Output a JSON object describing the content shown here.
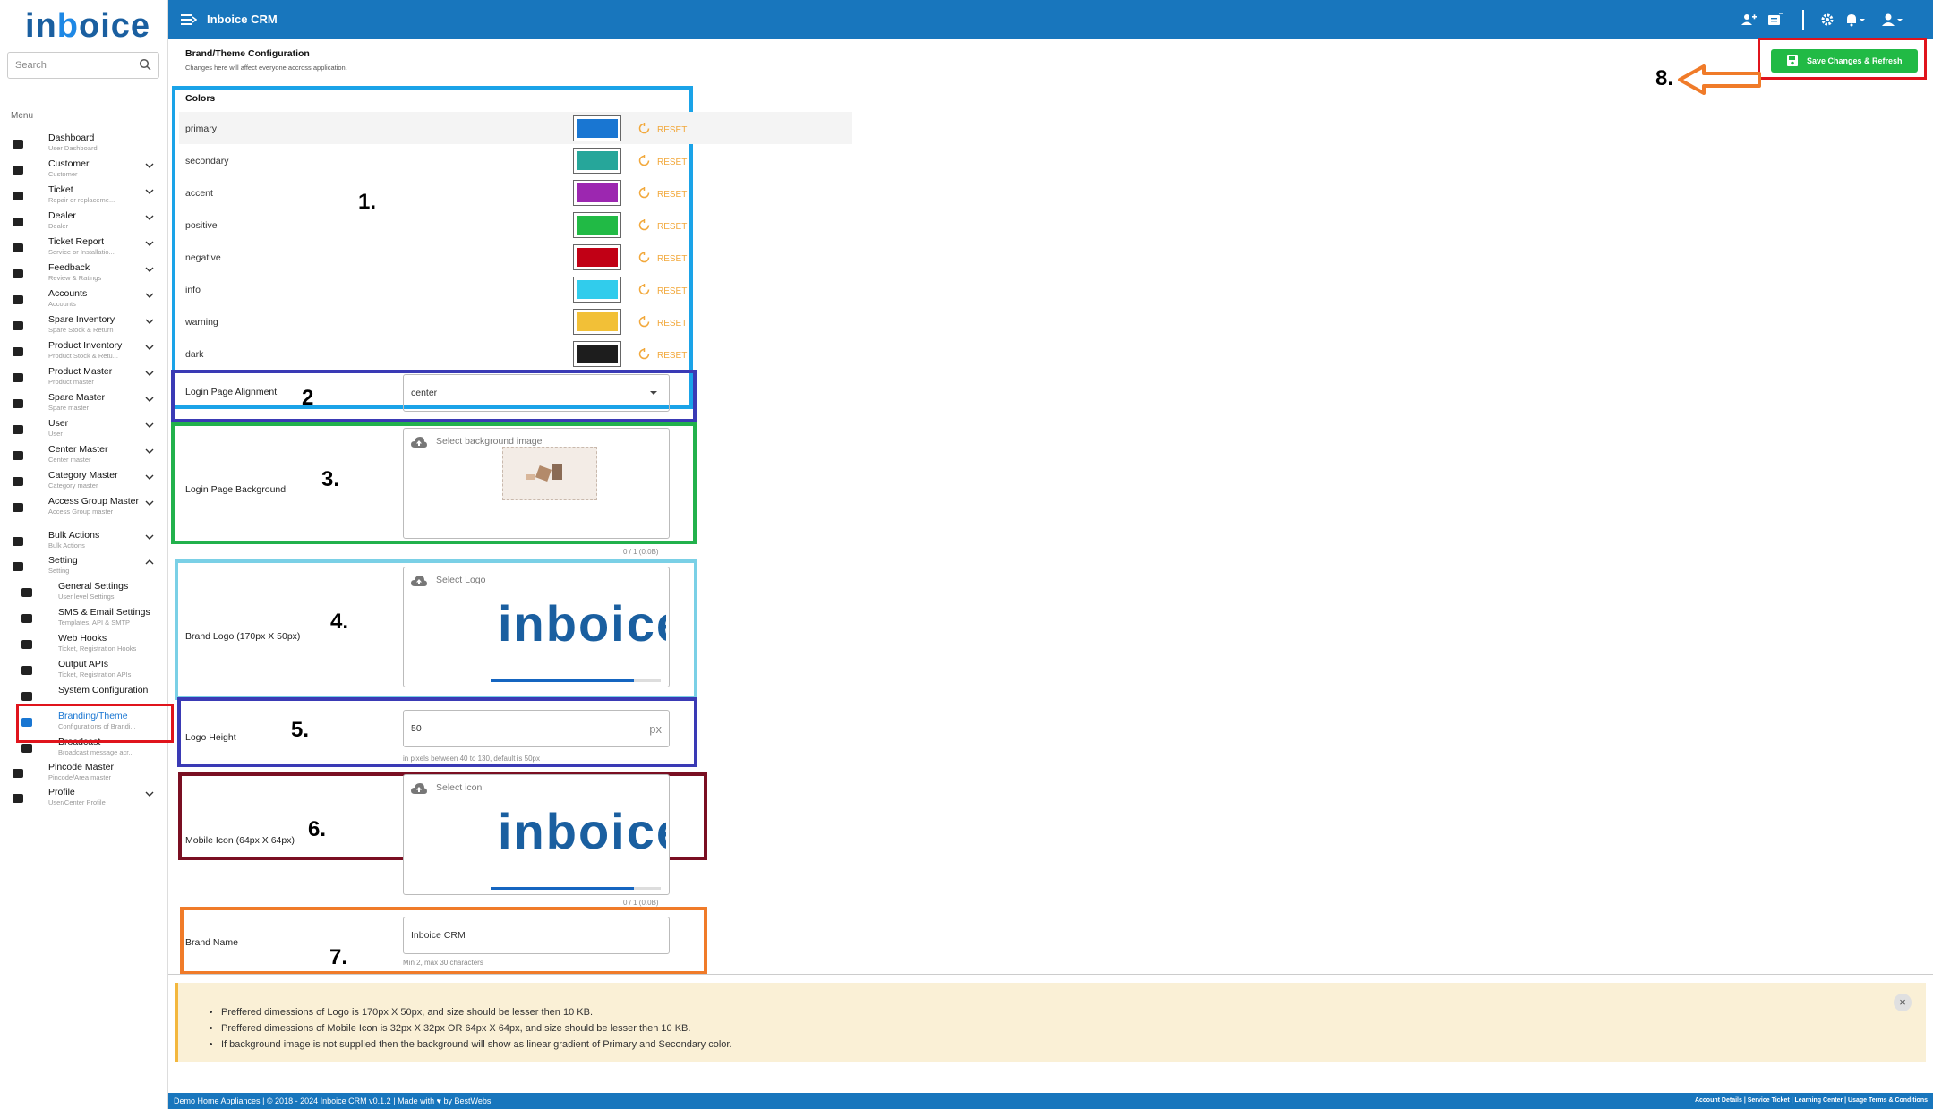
{
  "app": {
    "logo": "inboice",
    "title": "Inboice CRM"
  },
  "sidebar": {
    "search_placeholder": "Search",
    "menu_title": "Menu",
    "items": [
      {
        "label": "Dashboard",
        "sub": "User Dashboard"
      },
      {
        "label": "Customer",
        "sub": "Customer"
      },
      {
        "label": "Ticket",
        "sub": "Repair or replaceme..."
      },
      {
        "label": "Dealer",
        "sub": "Dealer"
      },
      {
        "label": "Ticket Report",
        "sub": "Service or Installatio..."
      },
      {
        "label": "Feedback",
        "sub": "Review & Ratings"
      },
      {
        "label": "Accounts",
        "sub": "Accounts"
      },
      {
        "label": "Spare Inventory",
        "sub": "Spare Stock & Return"
      },
      {
        "label": "Product Inventory",
        "sub": "Product Stock & Retu..."
      },
      {
        "label": "Product Master",
        "sub": "Product master"
      },
      {
        "label": "Spare Master",
        "sub": "Spare master"
      },
      {
        "label": "User",
        "sub": "User"
      },
      {
        "label": "Center Master",
        "sub": "Center master"
      },
      {
        "label": "Category Master",
        "sub": "Category master"
      },
      {
        "label": "Access Group Master",
        "sub": "Access Group master"
      },
      {
        "label": "Bulk Actions",
        "sub": "Bulk Actions"
      },
      {
        "label": "Setting",
        "sub": "Setting"
      },
      {
        "label": "General Settings",
        "sub": "User level Settings"
      },
      {
        "label": "SMS & Email Settings",
        "sub": "Templates, API & SMTP"
      },
      {
        "label": "Web Hooks",
        "sub": "Ticket, Registration Hooks"
      },
      {
        "label": "Output APIs",
        "sub": "Ticket, Registration APIs"
      },
      {
        "label": "System Configuration",
        "sub": ""
      },
      {
        "label": "Branding/Theme",
        "sub": "Configurations of Brandi..."
      },
      {
        "label": "Broadcast",
        "sub": "Broadcast message acr..."
      },
      {
        "label": "Pincode Master",
        "sub": "Pincode/Area master"
      },
      {
        "label": "Profile",
        "sub": "User/Center Profile"
      }
    ]
  },
  "page": {
    "title": "Brand/Theme Configuration",
    "subtitle": "Changes here will affect everyone accross application.",
    "save_label": "Save Changes & Refresh"
  },
  "colors": {
    "heading": "Colors",
    "reset_label": "RESET",
    "rows": [
      {
        "name": "primary",
        "hex": "#1976d2"
      },
      {
        "name": "secondary",
        "hex": "#26a69a"
      },
      {
        "name": "accent",
        "hex": "#9c27b0"
      },
      {
        "name": "positive",
        "hex": "#21ba45"
      },
      {
        "name": "negative",
        "hex": "#c10015"
      },
      {
        "name": "info",
        "hex": "#31ccec"
      },
      {
        "name": "warning",
        "hex": "#f2c037"
      },
      {
        "name": "dark",
        "hex": "#1d1d1d"
      }
    ]
  },
  "login_alignment": {
    "label": "Login Page Alignment",
    "value": "center"
  },
  "login_background": {
    "label": "Login Page Background",
    "upload_label": "Select background image",
    "count": "0 / 1 (0.0B)"
  },
  "brand_logo": {
    "label": "Brand Logo (170px X 50px)",
    "upload_label": "Select Logo",
    "preview_text": "inboice"
  },
  "logo_height": {
    "label": "Logo Height",
    "value": "50",
    "suffix": "px",
    "hint": "in pixels between 40 to 130, default is 50px"
  },
  "mobile_icon": {
    "label": "Mobile Icon (64px X 64px)",
    "upload_label": "Select icon",
    "preview_text": "inboice",
    "count": "0 / 1 (0.0B)"
  },
  "brand_name": {
    "label": "Brand Name",
    "value": "Inboice CRM",
    "hint": "Min 2, max 30 characters"
  },
  "annotations": [
    "1.",
    "2",
    "3.",
    "4.",
    "5.",
    "6.",
    "7.",
    "8."
  ],
  "notice": {
    "items": [
      "Preffered dimessions of Logo is 170px X 50px, and size should be lesser then 10 KB.",
      "Preffered dimessions of Mobile Icon is 32px X 32px OR 64px X 64px, and size should be lesser then 10 KB.",
      "If background image is not supplied then the background will show as linear gradient of Primary and Secondary color."
    ],
    "close": "×"
  },
  "footer": {
    "company": "Demo Home Appliances",
    "copyright": "© 2018 - 2024",
    "product": "Inboice CRM",
    "version": "v0.1.2",
    "made_with": "Made with",
    "by": "by",
    "author": "BestWebs",
    "links": "Account Details | Service Ticket | Learning Center | Usage Terms & Conditions"
  }
}
